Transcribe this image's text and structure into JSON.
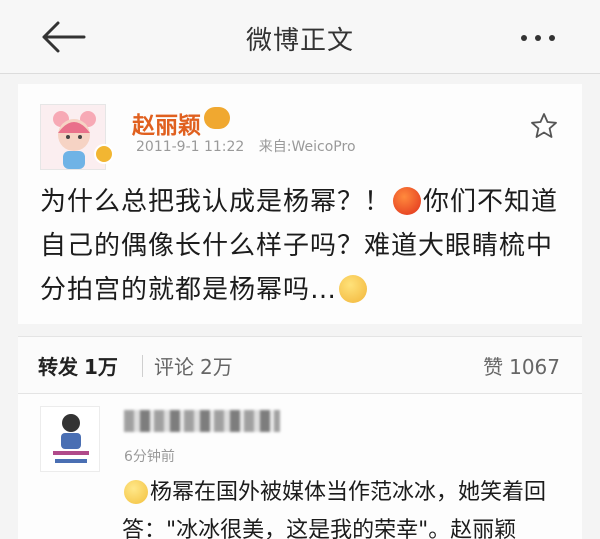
{
  "header": {
    "title": "微博正文"
  },
  "post": {
    "author": "赵丽颖",
    "date": "2011-9-1 11:22",
    "source": "来自:WeicoPro",
    "text_1": "为什么总把我认成是杨幂？！",
    "text_2": "你们不知道自己的偶像长什么样子吗？难道大眼睛梳中分拍宫的就都是杨幂吗…",
    "emoji_angry": "angry-emoji",
    "emoji_cry": "cry-emoji"
  },
  "actions": {
    "repost_label": "转发",
    "repost_count": "1万",
    "comment_label": "评论",
    "comment_count": "2万",
    "like_label": "赞",
    "like_count": "1067"
  },
  "comment": {
    "time": "6分钟前",
    "text": "杨幂在国外被媒体当作范冰冰，她笑着回答：\"冰冰很美，这是我的荣幸\"。赵丽颖"
  },
  "colors": {
    "author": "#e0601f",
    "accent": "#f2b632"
  }
}
